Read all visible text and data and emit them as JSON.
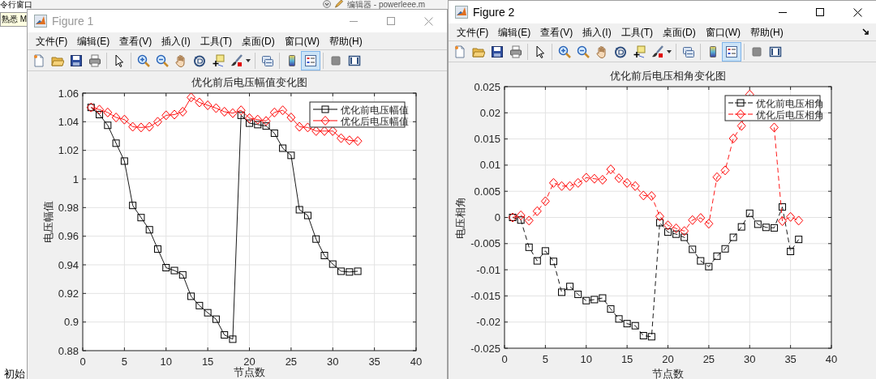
{
  "desktop": {
    "panel_title": "令行窗口",
    "tooltip": "熟悉 M",
    "editor_tab": "编辑器 - powerleee.m",
    "bottom_text": "初始"
  },
  "figures": [
    {
      "title": "Figure 1",
      "active": false,
      "menu": [
        "文件(F)",
        "编辑(E)",
        "查看(V)",
        "插入(I)",
        "工具(T)",
        "桌面(D)",
        "窗口(W)",
        "帮助(H)"
      ],
      "legend_button_on": true,
      "chart_data": {
        "type": "line",
        "grid": true,
        "legend": true,
        "title": "优化前后电压幅值变化图",
        "xlabel": "节点数",
        "ylabel": "电压幅值",
        "xlim": [
          0,
          40
        ],
        "ylim": [
          0.88,
          1.06
        ],
        "xticks": [
          0,
          5,
          10,
          15,
          20,
          25,
          30,
          35,
          40
        ],
        "yticks": [
          0.88,
          0.9,
          0.92,
          0.94,
          0.96,
          0.98,
          1,
          1.02,
          1.04,
          1.06
        ],
        "x": [
          1,
          2,
          3,
          4,
          5,
          6,
          7,
          8,
          9,
          10,
          11,
          12,
          13,
          14,
          15,
          16,
          17,
          18,
          19,
          20,
          21,
          22,
          23,
          24,
          25,
          26,
          27,
          28,
          29,
          30,
          31,
          32,
          33
        ],
        "series": [
          {
            "name": "优化前电压幅值",
            "color": "#000000",
            "line_style": "solid",
            "marker": "square",
            "values": [
              1.05,
              1.045,
              1.0375,
              1.025,
              1.0125,
              0.9815,
              0.973,
              0.9645,
              0.951,
              0.938,
              0.936,
              0.933,
              0.918,
              0.9115,
              0.9065,
              0.902,
              0.891,
              0.888,
              1.0445,
              1.039,
              1.038,
              1.037,
              1.032,
              1.0215,
              1.0165,
              0.9785,
              0.9745,
              0.958,
              0.9465,
              0.9405,
              0.9355,
              0.935,
              0.9355
            ]
          },
          {
            "name": "优化后电压幅值",
            "color": "#ff0000",
            "line_style": "solid",
            "marker": "diamond",
            "values": [
              1.05,
              1.0485,
              1.0465,
              1.043,
              1.0415,
              1.0365,
              1.036,
              1.0365,
              1.04,
              1.0445,
              1.045,
              1.047,
              1.057,
              1.0535,
              1.0515,
              1.0495,
              1.047,
              1.046,
              1.048,
              1.0425,
              1.0415,
              1.0405,
              1.0465,
              1.048,
              1.043,
              1.0365,
              1.036,
              1.0335,
              1.0335,
              1.0335,
              1.0285,
              1.027,
              1.0265
            ]
          }
        ]
      }
    },
    {
      "title": "Figure 2",
      "active": true,
      "menu": [
        "文件(F)",
        "编辑(E)",
        "查看(V)",
        "插入(I)",
        "工具(T)",
        "桌面(D)",
        "窗口(W)",
        "帮助(H)"
      ],
      "legend_button_on": true,
      "chart_data": {
        "type": "line",
        "grid": true,
        "legend": true,
        "title": "优化前后电压相角变化图",
        "xlabel": "节点数",
        "ylabel": "电压相角",
        "xlim": [
          0,
          40
        ],
        "ylim": [
          -0.025,
          0.025
        ],
        "xticks": [
          0,
          5,
          10,
          15,
          20,
          25,
          30,
          35,
          40
        ],
        "yticks": [
          -0.025,
          -0.02,
          -0.015,
          -0.01,
          -0.005,
          0,
          0.005,
          0.01,
          0.015,
          0.02,
          0.025
        ],
        "x": [
          1,
          2,
          3,
          4,
          5,
          6,
          7,
          8,
          9,
          10,
          11,
          12,
          13,
          14,
          15,
          16,
          17,
          18,
          19,
          20,
          21,
          22,
          23,
          24,
          25,
          26,
          27,
          28,
          29,
          30,
          31,
          32,
          33,
          34,
          35,
          36
        ],
        "series": [
          {
            "name": "优化前电压相角",
            "color": "#000000",
            "line_style": "dashed",
            "marker": "square",
            "values": [
              0,
              -0.0005,
              -0.0057,
              -0.0083,
              -0.0064,
              -0.0084,
              -0.0143,
              -0.0132,
              -0.0147,
              -0.0159,
              -0.0157,
              -0.0154,
              -0.0175,
              -0.0194,
              -0.0203,
              -0.0207,
              -0.0226,
              -0.0228,
              -0.001,
              -0.0028,
              -0.0032,
              -0.0038,
              -0.0061,
              -0.0083,
              -0.0094,
              -0.0074,
              -0.006,
              -0.0038,
              -0.0018,
              0.0008,
              -0.0013,
              -0.0019,
              -0.002,
              0.002,
              -0.0065,
              -0.0042
            ]
          },
          {
            "name": "优化后电压相角",
            "color": "#ff0000",
            "line_style": "dashed",
            "marker": "diamond",
            "values": [
              0,
              0.0004,
              -0.0006,
              0.0012,
              0.0031,
              0.0066,
              0.006,
              0.006,
              0.0066,
              0.0076,
              0.0074,
              0.0072,
              0.0092,
              0.0075,
              0.0066,
              0.006,
              0.0042,
              0.0041,
              0.0002,
              -0.0015,
              -0.0021,
              -0.0026,
              -0.0005,
              -0.0001,
              -0.0012,
              0.0077,
              0.009,
              0.0151,
              0.0175,
              0.0235,
              null,
              null,
              0.0172,
              -0.0007,
              0.0001,
              -0.0006
            ]
          }
        ]
      }
    }
  ]
}
